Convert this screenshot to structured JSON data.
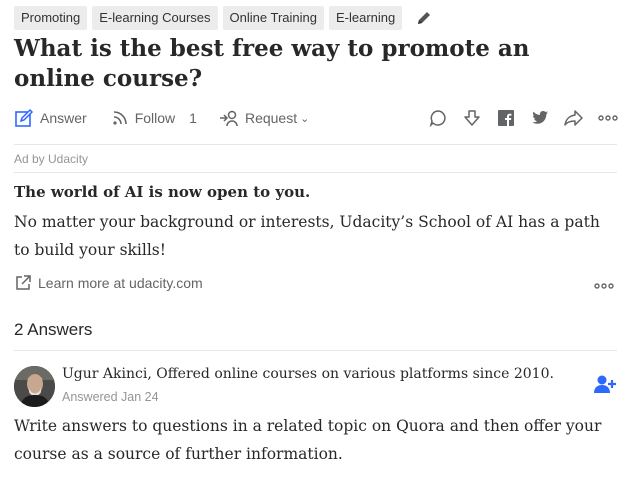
{
  "topics": [
    "Promoting",
    "E-learning Courses",
    "Online Training",
    "E-learning"
  ],
  "question": {
    "title": "What is the best free way to promote an online course?"
  },
  "actions": {
    "answer_label": "Answer",
    "follow_label": "Follow",
    "follow_count": "1",
    "request_label": "Request"
  },
  "ad": {
    "label": "Ad by Udacity",
    "headline": "The world of AI is now open to you.",
    "body": "No matter your background or interests, Udacity’s School of AI has a path to build your skills!",
    "link_text": "Learn more at udacity.com"
  },
  "answers": {
    "count_label": "2 Answers",
    "items": [
      {
        "author": "Ugur Akinci",
        "credential": "Offered online courses on various platforms since 2010.",
        "date": "Answered Jan 24",
        "text": "Write answers to questions in a related topic on Quora and then offer your course as a source of further information."
      }
    ]
  },
  "icons": {
    "edit": "pencil-icon",
    "answer": "pen-square-icon",
    "follow": "rss-icon",
    "request": "request-user-icon",
    "comment": "comment-icon",
    "downvote": "downvote-icon",
    "facebook": "facebook-icon",
    "twitter": "twitter-icon",
    "share": "share-icon",
    "more": "more-icon",
    "external_link": "external-link-icon",
    "follow_user": "add-user-icon"
  },
  "colors": {
    "text": "#282829",
    "muted": "#636466",
    "light": "#939598",
    "topic_bg": "#ececec",
    "accent_blue": "#2e69ff"
  }
}
